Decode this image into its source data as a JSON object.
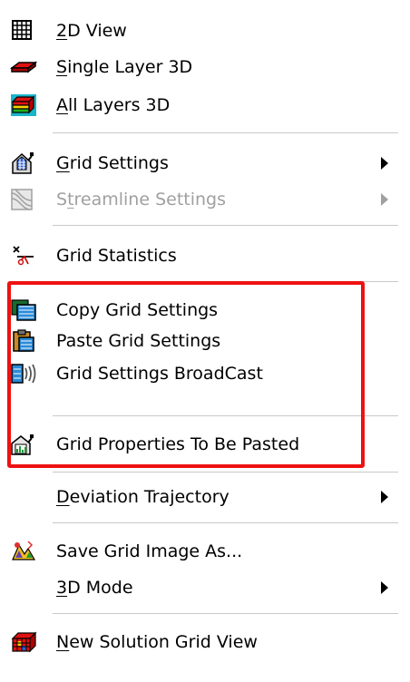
{
  "menu": {
    "items": [
      {
        "pre": "",
        "u": "2",
        "post": "D View",
        "icon": "grid-icon"
      },
      {
        "pre": "",
        "u": "S",
        "post": "ingle Layer 3D",
        "icon": "single-layer-icon"
      },
      {
        "pre": "",
        "u": "A",
        "post": "ll Layers 3D",
        "icon": "all-layers-icon"
      },
      {
        "pre": "",
        "u": "G",
        "post": "rid Settings",
        "icon": "grid-settings-icon",
        "submenu": true
      },
      {
        "pre": "S",
        "u": "t",
        "post": "reamline Settings",
        "icon": "streamline-settings-icon",
        "submenu": true,
        "disabled": true
      },
      {
        "pre": "Grid Statistics",
        "u": "",
        "post": "",
        "icon": "statistics-icon"
      },
      {
        "pre": "Copy Grid Settings",
        "u": "",
        "post": "",
        "icon": "copy-icon"
      },
      {
        "pre": "Paste Grid Settings",
        "u": "",
        "post": "",
        "icon": "paste-icon"
      },
      {
        "pre": "Grid Settings BroadCast",
        "u": "",
        "post": "",
        "icon": "broadcast-icon"
      },
      {
        "pre": "Grid Properties To Be Pasted",
        "u": "",
        "post": "",
        "icon": "properties-icon"
      },
      {
        "pre": "",
        "u": "D",
        "post": "eviation Trajectory",
        "icon": "",
        "submenu": true
      },
      {
        "pre": "Save Grid Image As...",
        "u": "",
        "post": "",
        "icon": "save-image-icon"
      },
      {
        "pre": "",
        "u": "3",
        "post": "D Mode",
        "icon": "",
        "submenu": true
      },
      {
        "pre": "",
        "u": "N",
        "post": "ew Solution Grid View",
        "icon": "solution-grid-icon"
      }
    ]
  },
  "colors": {
    "highlight_border": "#ee1111",
    "disabled_text": "#a0a0a0",
    "separator": "#c9c9c9"
  }
}
